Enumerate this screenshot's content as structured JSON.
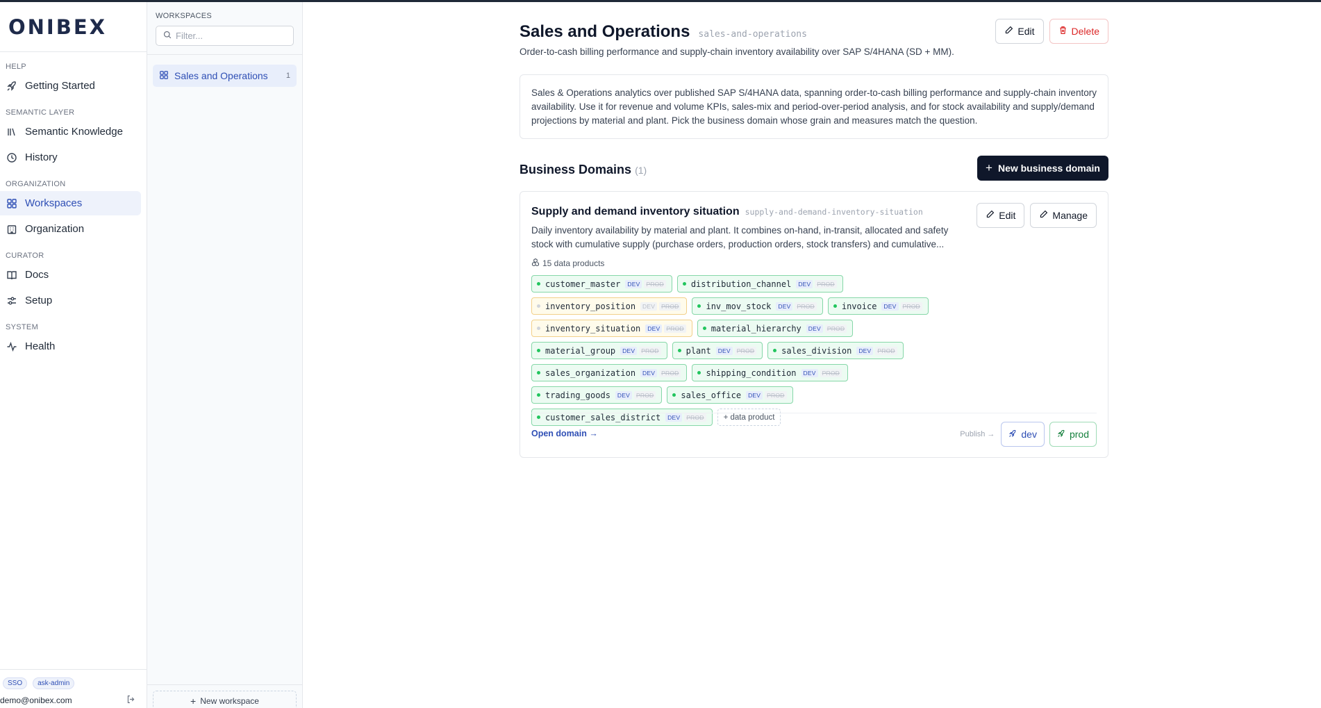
{
  "brand": {
    "logo_text": "ONIBEX"
  },
  "nav": {
    "sections": [
      {
        "title": "HELP",
        "items": [
          {
            "label": "Getting Started",
            "icon": "rocket-icon"
          }
        ]
      },
      {
        "title": "SEMANTIC LAYER",
        "items": [
          {
            "label": "Semantic Knowledge",
            "icon": "library-icon"
          },
          {
            "label": "History",
            "icon": "clock-icon"
          }
        ]
      },
      {
        "title": "ORGANIZATION",
        "items": [
          {
            "label": "Workspaces",
            "icon": "grid-icon",
            "active": true
          },
          {
            "label": "Organization",
            "icon": "building-icon"
          }
        ]
      },
      {
        "title": "CURATOR",
        "items": [
          {
            "label": "Docs",
            "icon": "book-icon"
          },
          {
            "label": "Setup",
            "icon": "sliders-icon"
          }
        ]
      },
      {
        "title": "SYSTEM",
        "items": [
          {
            "label": "Health",
            "icon": "activity-icon"
          }
        ]
      }
    ],
    "badges": [
      "SSO",
      "ask-admin"
    ],
    "user_email": "demo@onibex.com"
  },
  "workspaces_panel": {
    "title": "WORKSPACES",
    "filter_placeholder": "Filter...",
    "items": [
      {
        "label": "Sales and Operations",
        "count": "1"
      }
    ],
    "new_label": "New workspace"
  },
  "workspace": {
    "title": "Sales and Operations",
    "slug": "sales-and-operations",
    "subtitle": "Order-to-cash billing performance and supply-chain inventory availability over SAP S/4HANA (SD + MM).",
    "edit_label": "Edit",
    "delete_label": "Delete",
    "description": "Sales & Operations analytics over published SAP S/4HANA data, spanning order-to-cash billing performance and supply-chain inventory availability. Use it for revenue and volume KPIs, sales-mix and period-over-period analysis, and for stock availability and supply/demand projections by material and plant. Pick the business domain whose grain and measures match the question."
  },
  "business_domains": {
    "title": "Business Domains",
    "count": "(1)",
    "new_label": "New business domain",
    "domain": {
      "title": "Supply and demand inventory situation",
      "slug": "supply-and-demand-inventory-situation",
      "description": "Daily inventory availability by material and plant. It combines on-hand, in-transit, allocated and safety stock with cumulative supply (purchase orders, production orders, stock transfers) and cumulative...",
      "data_products_count": "15 data products",
      "edit_label": "Edit",
      "manage_label": "Manage",
      "dev_tag": "DEV",
      "prod_tag": "PROD",
      "products": [
        {
          "name": "customer_master",
          "status": "ok"
        },
        {
          "name": "distribution_channel",
          "status": "ok"
        },
        {
          "name": "inventory_position",
          "status": "warn",
          "dev_off": true
        },
        {
          "name": "inv_mov_stock",
          "status": "ok"
        },
        {
          "name": "invoice",
          "status": "ok"
        },
        {
          "name": "inventory_situation",
          "status": "warn"
        },
        {
          "name": "material_hierarchy",
          "status": "ok"
        },
        {
          "name": "material_group",
          "status": "ok"
        },
        {
          "name": "plant",
          "status": "ok"
        },
        {
          "name": "sales_division",
          "status": "ok"
        },
        {
          "name": "sales_organization",
          "status": "ok"
        },
        {
          "name": "shipping_condition",
          "status": "ok"
        },
        {
          "name": "trading_goods",
          "status": "ok"
        },
        {
          "name": "sales_office",
          "status": "ok"
        },
        {
          "name": "customer_sales_district",
          "status": "ok"
        }
      ],
      "add_product_label": "+ data product",
      "open_label": "Open domain →",
      "publish_label": "Publish →",
      "publish_dev_label": "dev",
      "publish_prod_label": "prod"
    }
  }
}
